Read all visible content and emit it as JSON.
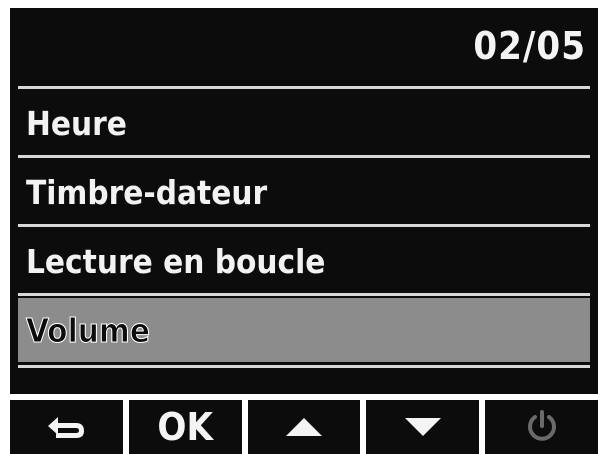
{
  "header": {
    "page_counter": "02/05"
  },
  "menu": {
    "items": [
      {
        "label": "Heure",
        "selected": false
      },
      {
        "label": "Timbre-dateur",
        "selected": false
      },
      {
        "label": "Lecture en boucle",
        "selected": false
      },
      {
        "label": "Volume",
        "selected": true
      }
    ]
  },
  "softkeys": {
    "back_icon": "return-arrow-icon",
    "ok_label": "OK",
    "up_icon": "triangle-up-icon",
    "down_icon": "triangle-down-icon",
    "power_icon": "power-icon",
    "power_color": "#6a6a6a"
  }
}
